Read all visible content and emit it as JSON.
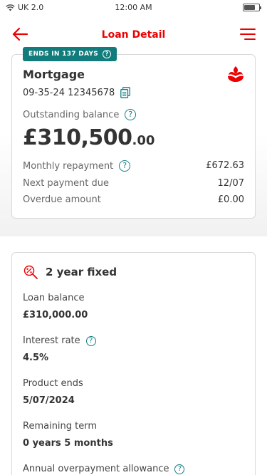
{
  "status_bar": {
    "carrier": "UK 2.0",
    "time": "12:00 AM",
    "battery_level": 0.75
  },
  "nav": {
    "back_icon": "arrow-left-icon",
    "title": "Loan Detail",
    "menu_icon": "hamburger-menu-icon"
  },
  "colors": {
    "brand_red": "#ec0000",
    "badge_teal": "#127b7b",
    "help_teal": "#137e84"
  },
  "account": {
    "badge": "ENDS IN 137 DAYS",
    "badge_help": "?",
    "title": "Mortgage",
    "brand_icon": "flame-logo-icon",
    "number": "09-35-24 12345678",
    "copy_icon": "copy-icon",
    "balance_label": "Outstanding balance",
    "balance_main": "£310,500",
    "balance_pence": ".00",
    "details": [
      {
        "label": "Monthly repayment",
        "value": "£672.63",
        "help": true
      },
      {
        "label": "Next payment due",
        "value": "12/07",
        "help": false
      },
      {
        "label": "Overdue amount",
        "value": "£0.00",
        "help": false
      }
    ]
  },
  "product": {
    "icon": "search-percent-icon",
    "title": "2 year fixed",
    "fields": [
      {
        "label": "Loan balance",
        "value": "£310,000.00",
        "help": false
      },
      {
        "label": "Interest rate",
        "value": "4.5%",
        "help": true
      },
      {
        "label": "Product ends",
        "value": "5/07/2024",
        "help": false
      },
      {
        "label": "Remaining term",
        "value": "0 years 5 months",
        "help": false
      },
      {
        "label": "Annual overpayment allowance",
        "value": "",
        "help": true
      }
    ]
  },
  "help_glyph": "?"
}
